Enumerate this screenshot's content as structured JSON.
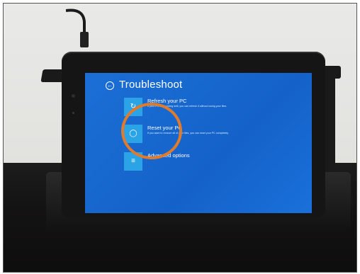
{
  "screen": {
    "title": "Troubleshoot",
    "options": [
      {
        "title": "Refresh your PC",
        "description": "If your PC isn't running well, you can refresh it without losing your files."
      },
      {
        "title": "Reset your PC",
        "description": "If you want to remove all of your files, you can reset your PC completely."
      },
      {
        "title": "Advanced options",
        "description": ""
      }
    ]
  },
  "colors": {
    "screen_blue": "#1566cf",
    "tile_blue": "#2aa4e6",
    "highlight_ring": "#e07b2b"
  },
  "icons": [
    "back-arrow-icon",
    "refresh-icon",
    "reset-icon",
    "advanced-options-icon"
  ]
}
